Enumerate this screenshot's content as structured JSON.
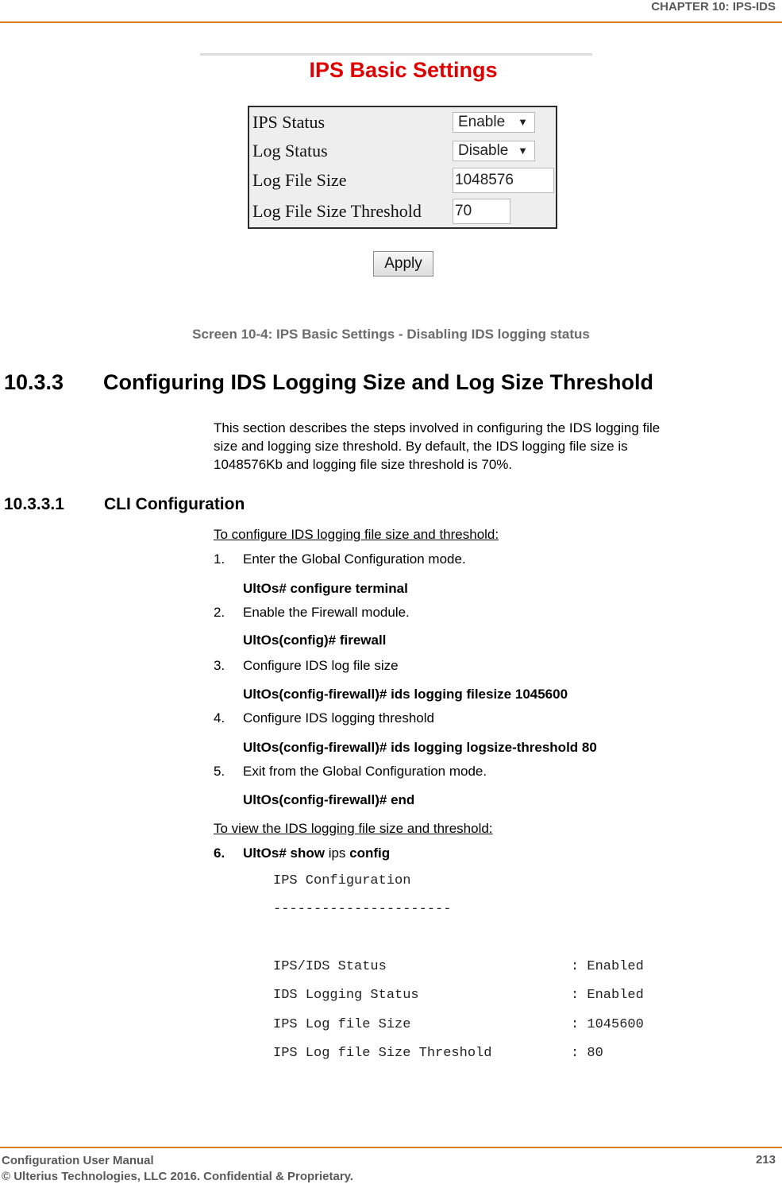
{
  "header": {
    "chapter": "CHAPTER 10: IPS-IDS"
  },
  "figure": {
    "title": "IPS Basic Settings",
    "rows": [
      {
        "label": "IPS Status",
        "type": "select",
        "value": "Enable"
      },
      {
        "label": "Log Status",
        "type": "select",
        "value": "Disable"
      },
      {
        "label": "Log File Size",
        "type": "text",
        "value": "1048576"
      },
      {
        "label": "Log File Size Threshold",
        "type": "text",
        "value": "70"
      }
    ],
    "apply_label": "Apply",
    "dropdown_arrow": "▼"
  },
  "caption": "Screen 10-4: IPS Basic Settings - Disabling IDS logging status",
  "section": {
    "number": "10.3.3",
    "title": "Configuring IDS Logging Size and Log Size Threshold",
    "paragraph_lines": [
      "This section describes the steps involved in configuring the IDS logging file",
      "size and logging size threshold. By default, the IDS logging file size is",
      "1048576Kb and logging file size threshold is 70%."
    ]
  },
  "subsection": {
    "number": "10.3.3.1",
    "title": "CLI Configuration"
  },
  "procedure": {
    "configure_title": "To configure IDS logging file size and threshold:",
    "steps": [
      {
        "n": "1.",
        "text": "Enter the Global Configuration mode.",
        "cmd": "UltOs# configure terminal"
      },
      {
        "n": "2.",
        "text": "Enable the Firewall module.",
        "cmd": "UltOs(config)# firewall"
      },
      {
        "n": "3.",
        "text": "Configure IDS log file size",
        "cmd": "UltOs(config-firewall)# ids logging filesize 1045600"
      },
      {
        "n": "4.",
        "text": "Configure IDS logging threshold",
        "cmd": "UltOs(config-firewall)# ids logging logsize-threshold 80"
      },
      {
        "n": "5.",
        "text": "Exit from the Global Configuration mode.",
        "cmd": "UltOs(config-firewall)# end"
      }
    ],
    "view_title": "To view the IDS logging file size and threshold:",
    "view_step": {
      "n": "6.",
      "bold1": "UltOs# show",
      "plain": " ips ",
      "bold2": "config"
    }
  },
  "output": {
    "title": "IPS Configuration",
    "separator": "----------------------",
    "rows": [
      {
        "key": "IPS/IDS Status",
        "value": "Enabled"
      },
      {
        "key": "IDS Logging Status",
        "value": "Enabled"
      },
      {
        "key": "IPS Log file Size",
        "value": "1045600"
      },
      {
        "key": "IPS Log file Size Threshold",
        "value": "80"
      }
    ]
  },
  "footer": {
    "manual": "Configuration User Manual",
    "copyright": "© Ulterius Technologies, LLC 2016. Confidential & Proprietary.",
    "page": "213"
  }
}
